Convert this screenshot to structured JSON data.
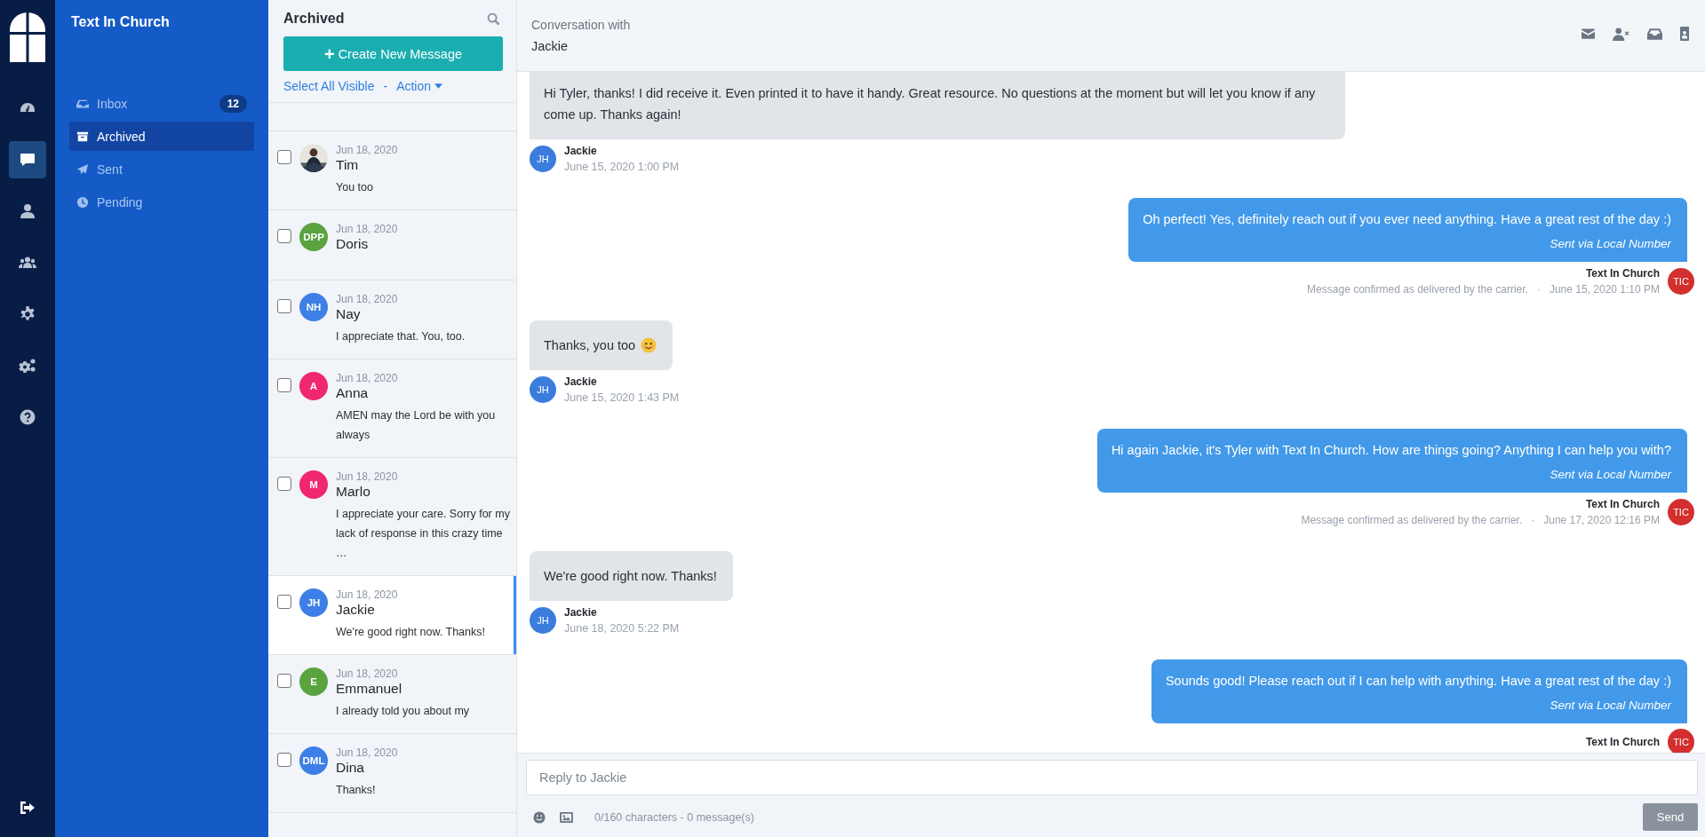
{
  "rail": {
    "items": [
      {
        "selected": false
      },
      {
        "selected": true
      },
      {
        "selected": false
      },
      {
        "selected": false
      },
      {
        "selected": false
      },
      {
        "selected": false
      },
      {
        "selected": false
      }
    ]
  },
  "brand": "Text In Church",
  "folders": [
    {
      "label": "Inbox",
      "count": "12",
      "selected": false
    },
    {
      "label": "Archived",
      "selected": true
    },
    {
      "label": "Sent",
      "selected": false
    },
    {
      "label": "Pending",
      "selected": false
    }
  ],
  "list": {
    "title": "Archived",
    "create_icon": "+",
    "create_button": "Create New Message",
    "select_all": "Select All Visible",
    "separator": "-",
    "action": "Action",
    "conversations": [
      {
        "kind": "picture",
        "date": "Jun 18, 2020",
        "name": "Tim",
        "preview": "You too",
        "checked": false,
        "selected": false
      },
      {
        "kind": "initials",
        "initials": "DPP",
        "color": "#5aa33f",
        "date": "Jun 18, 2020",
        "name": "Doris",
        "checked": false,
        "selected": false
      },
      {
        "kind": "initials",
        "initials": "NH",
        "color": "#3d7fe6",
        "date": "Jun 18, 2020",
        "name": "Nay",
        "preview": "I appreciate that. You, too.",
        "checked": false,
        "selected": false
      },
      {
        "kind": "initials",
        "initials": "A",
        "color": "#f0276e",
        "date": "Jun 18, 2020",
        "name": "Anna",
        "preview": "AMEN may the Lord be with you always",
        "checked": false,
        "selected": false
      },
      {
        "kind": "initials",
        "initials": "M",
        "color": "#f0276e",
        "date": "Jun 18, 2020",
        "name": "Marlo",
        "preview": "I appreciate your care. Sorry for my lack of response in this crazy time …",
        "checked": false,
        "selected": false
      },
      {
        "kind": "initials",
        "initials": "JH",
        "color": "#3d7fe6",
        "date": "Jun 18, 2020",
        "name": "Jackie",
        "preview": "We're good right now. Thanks!",
        "checked": false,
        "selected": true
      },
      {
        "kind": "initials",
        "initials": "E",
        "color": "#5aa33f",
        "date": "Jun 18, 2020",
        "name": "Emmanuel",
        "preview": "I already told you about my",
        "checked": false,
        "selected": false
      },
      {
        "kind": "initials",
        "initials": "DML",
        "color": "#3d7fe6",
        "date": "Jun 18, 2020",
        "name": "Dina",
        "preview": "Thanks!",
        "checked": false,
        "selected": false
      }
    ]
  },
  "conversation": {
    "heading": "Conversation with",
    "contact": "Jackie",
    "messages": [
      {
        "kind": "incoming",
        "text": "Hi Tyler, thanks! I did receive it. Even printed it to have it handy. Great resource. No questions at the moment but will let you know if any come up. Thanks again!",
        "sender": "Jackie",
        "initials": "JH",
        "time": "June 15, 2020 1:00 PM"
      },
      {
        "kind": "outgoing",
        "text": "Oh perfect! Yes, definitely reach out if you ever need anything. Have a great rest of the day :)",
        "note": "Sent via Local Number",
        "sender": "Text In Church",
        "initials": "TIC",
        "status": "Message confirmed as delivered by the carrier.",
        "separator": "·",
        "time": "June 15, 2020 1:10 PM"
      },
      {
        "kind": "incoming",
        "text": "Thanks, you too",
        "emoji": true,
        "sender": "Jackie",
        "initials": "JH",
        "time": "June 15, 2020 1:43 PM"
      },
      {
        "kind": "outgoing",
        "text": "Hi again Jackie, it's Tyler with Text In Church. How are things going? Anything I can help you with?",
        "note": "Sent via Local Number",
        "sender": "Text In Church",
        "initials": "TIC",
        "status": "Message confirmed as delivered by the carrier.",
        "separator": "·",
        "time": "June 17, 2020 12:16 PM"
      },
      {
        "kind": "incoming",
        "text": "We're good right now. Thanks!",
        "sender": "Jackie",
        "initials": "JH",
        "time": "June 18, 2020 5:22 PM"
      },
      {
        "kind": "outgoing",
        "text": "Sounds good! Please reach out if I can help with anything. Have a great rest of the day :)",
        "note": "Sent via Local Number",
        "sender": "Text In Church",
        "initials": "TIC"
      }
    ]
  },
  "composer": {
    "placeholder": "Reply to Jackie",
    "counter": "0/160 characters - 0 message(s)",
    "send": "Send"
  }
}
